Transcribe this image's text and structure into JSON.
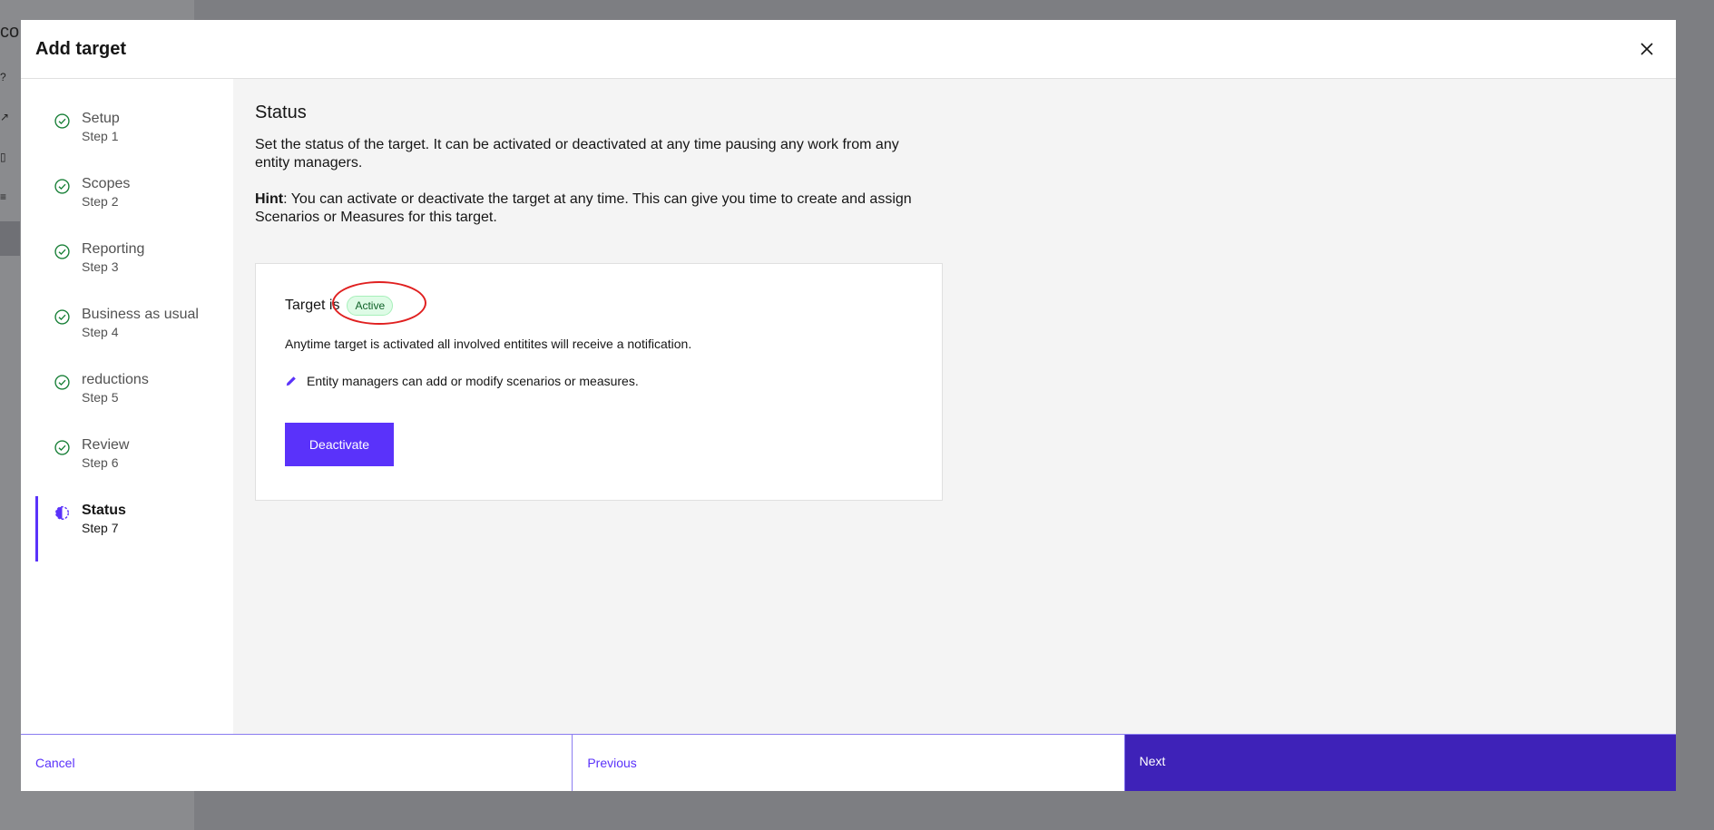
{
  "background": {
    "partial_text": "co"
  },
  "modal": {
    "title": "Add target",
    "close_icon": "close-icon"
  },
  "steps": [
    {
      "label": "Setup",
      "sub": "Step 1",
      "state": "complete"
    },
    {
      "label": "Scopes",
      "sub": "Step 2",
      "state": "complete"
    },
    {
      "label": "Reporting",
      "sub": "Step 3",
      "state": "complete"
    },
    {
      "label": "Business as usual",
      "sub": "Step 4",
      "state": "complete"
    },
    {
      "label": "reductions",
      "sub": "Step 5",
      "state": "complete"
    },
    {
      "label": "Review",
      "sub": "Step 6",
      "state": "complete"
    },
    {
      "label": "Status",
      "sub": "Step 7",
      "state": "current"
    }
  ],
  "content": {
    "title": "Status",
    "description": "Set the status of the target. It can be activated or deactivated at any time pausing any work from any entity managers.",
    "hint_label": "Hint",
    "hint_text": ": You can activate or deactivate the target at any time. This can give you time to create and assign Scenarios or Measures for this target."
  },
  "card": {
    "status_prefix": "Target is",
    "status_badge": "Active",
    "notice": "Anytime target is activated all involved entitites will receive a notification.",
    "permission": "Entity managers can add or modify scenarios or measures.",
    "action_label": "Deactivate"
  },
  "footer": {
    "cancel": "Cancel",
    "previous": "Previous",
    "next": "Next"
  },
  "colors": {
    "primary": "#5a32fa",
    "next_bg": "#3e22b8",
    "success": "#198038",
    "badge_bg": "#defbe6",
    "badge_text": "#0e6027",
    "annotation": "#e02020"
  }
}
